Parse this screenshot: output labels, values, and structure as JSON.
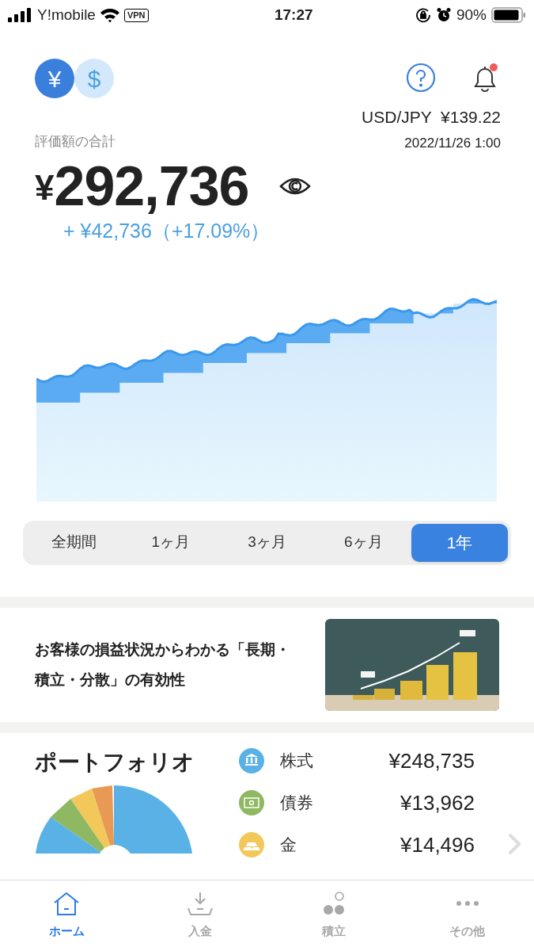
{
  "status_bar": {
    "carrier": "Y!mobile",
    "vpn": "VPN",
    "time": "17:27",
    "battery": "90%"
  },
  "header": {
    "currencies": [
      {
        "symbol": "¥",
        "selected": true
      },
      {
        "symbol": "$",
        "selected": false
      }
    ],
    "notification_unread": true
  },
  "rate": {
    "pair": "USD/JPY",
    "value": "¥139.22",
    "timestamp": "2022/11/26 1:00"
  },
  "total": {
    "label": "評価額の合計",
    "currency": "¥",
    "amount": "292,736",
    "change": "+ ¥42,736（+17.09%）"
  },
  "periods": [
    {
      "label": "全期間",
      "selected": false
    },
    {
      "label": "1ヶ月",
      "selected": false
    },
    {
      "label": "3ヶ月",
      "selected": false
    },
    {
      "label": "6ヶ月",
      "selected": false
    },
    {
      "label": "1年",
      "selected": true
    }
  ],
  "article": {
    "title": "お客様の損益状況からわかる「長期・積立・分散」の有効性"
  },
  "portfolio": {
    "title": "ポートフォリオ",
    "assets": [
      {
        "kind": "stock",
        "name": "株式",
        "value": "¥248,735",
        "color": "#5ab1e6"
      },
      {
        "kind": "bond",
        "name": "債券",
        "value": "¥13,962",
        "color": "#8fb862"
      },
      {
        "kind": "gold",
        "name": "金",
        "value": "¥14,496",
        "color": "#f2c85b"
      }
    ]
  },
  "tabs": [
    {
      "kind": "home",
      "label": "ホーム",
      "selected": true
    },
    {
      "kind": "deposit",
      "label": "入金",
      "selected": false
    },
    {
      "kind": "savings",
      "label": "積立",
      "selected": false
    },
    {
      "kind": "more",
      "label": "その他",
      "selected": false
    }
  ]
}
